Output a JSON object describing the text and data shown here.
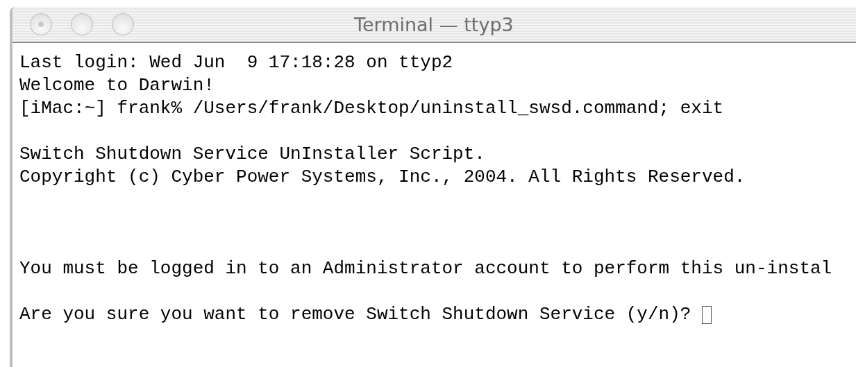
{
  "window": {
    "title": "Terminal — ttyp3"
  },
  "lines": [
    {
      "kind": "text",
      "text": "Last login: Wed Jun  9 17:18:28 on ttyp2"
    },
    {
      "kind": "text",
      "text": "Welcome to Darwin!"
    },
    {
      "kind": "text",
      "text": "[iMac:~] frank% /Users/frank/Desktop/uninstall_swsd.command; exit"
    },
    {
      "kind": "blank"
    },
    {
      "kind": "text",
      "text": "Switch Shutdown Service UnInstaller Script."
    },
    {
      "kind": "text",
      "text": "Copyright (c) Cyber Power Systems, Inc., 2004. All Rights Reserved."
    },
    {
      "kind": "blank"
    },
    {
      "kind": "blank"
    },
    {
      "kind": "blank"
    },
    {
      "kind": "text",
      "text": "You must be logged in to an Administrator account to perform this un-instal"
    },
    {
      "kind": "blank"
    },
    {
      "kind": "prompt",
      "text": "Are you sure you want to remove Switch Shutdown Service (y/n)? "
    }
  ]
}
